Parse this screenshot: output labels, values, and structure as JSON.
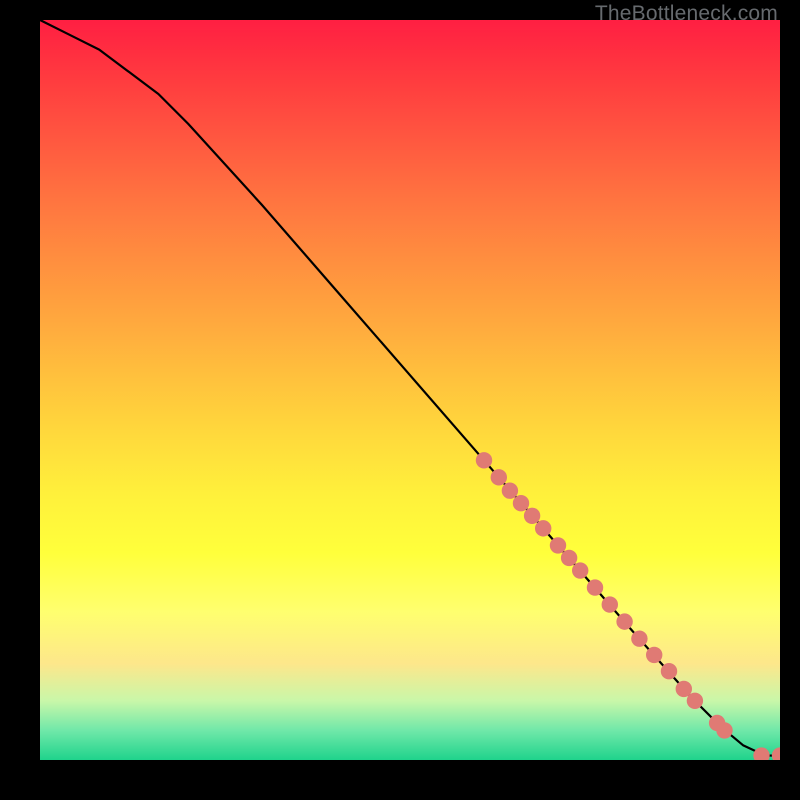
{
  "watermark": "TheBottleneck.com",
  "chart_data": {
    "type": "line",
    "title": "",
    "xlabel": "",
    "ylabel": "",
    "xlim": [
      0,
      100
    ],
    "ylim": [
      0,
      100
    ],
    "series": [
      {
        "name": "curve",
        "x": [
          0,
          4,
          8,
          12,
          16,
          20,
          30,
          40,
          50,
          60,
          70,
          80,
          88,
          92,
          95,
          98,
          100
        ],
        "y": [
          100,
          98,
          96,
          93,
          90,
          86,
          75,
          63.5,
          52,
          40.5,
          29,
          17.5,
          8.5,
          4.5,
          2.0,
          0.6,
          0.6
        ]
      }
    ],
    "markers": {
      "name": "highlight-points",
      "color": "#e07a74",
      "points_xy": [
        [
          60,
          40.5
        ],
        [
          62,
          38.2
        ],
        [
          63.5,
          36.4
        ],
        [
          65,
          34.7
        ],
        [
          66.5,
          33.0
        ],
        [
          68,
          31.3
        ],
        [
          70,
          29.0
        ],
        [
          71.5,
          27.3
        ],
        [
          73,
          25.6
        ],
        [
          75,
          23.3
        ],
        [
          77,
          21.0
        ],
        [
          79,
          18.7
        ],
        [
          81,
          16.4
        ],
        [
          83,
          14.2
        ],
        [
          85,
          12.0
        ],
        [
          87,
          9.6
        ],
        [
          88.5,
          8.0
        ],
        [
          91.5,
          5.0
        ],
        [
          92.5,
          4.0
        ],
        [
          97.5,
          0.6
        ],
        [
          100,
          0.6
        ]
      ]
    }
  }
}
